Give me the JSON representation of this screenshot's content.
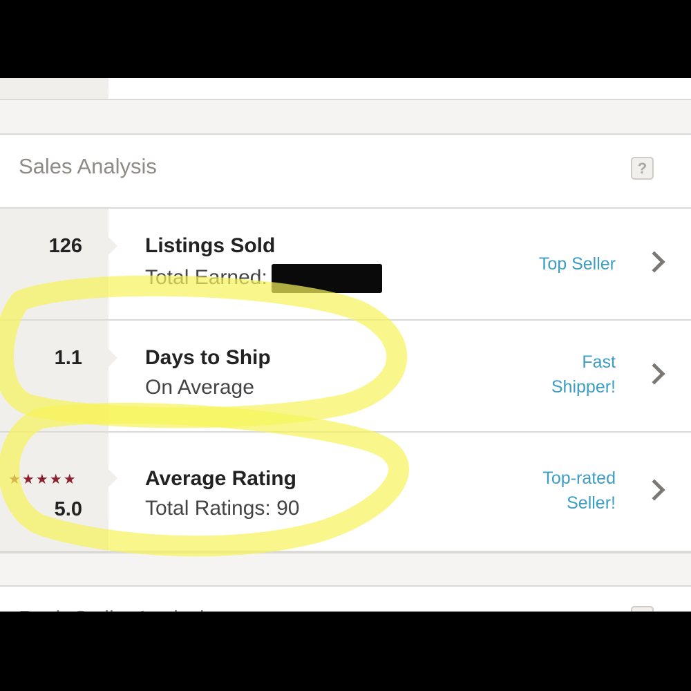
{
  "section": {
    "title": "Sales Analysis",
    "help_label": "?"
  },
  "next_section": {
    "title": "Posh Stylist Analysis"
  },
  "rows": [
    {
      "stat": "126",
      "title": "Listings Sold",
      "subtitle": "Total Earned:",
      "badge": "Top Seller"
    },
    {
      "stat": "1.1",
      "title": "Days to Ship",
      "subtitle": "On Average",
      "badge_line1": "Fast",
      "badge_line2": "Shipper!"
    },
    {
      "stars": "★★★★★",
      "stat": "5.0",
      "rating_value": 5.0,
      "rating_max": 5,
      "title": "Average Rating",
      "subtitle": "Total Ratings: 90",
      "badge_line1": "Top-rated",
      "badge_line2": "Seller!"
    }
  ],
  "colors": {
    "badge": "#3d9dc2",
    "stars": "#8d2030",
    "highlighter": "#f7f35a"
  },
  "icons": {
    "help": "question-mark-icon",
    "row_arrow": "chevron-right-icon"
  }
}
